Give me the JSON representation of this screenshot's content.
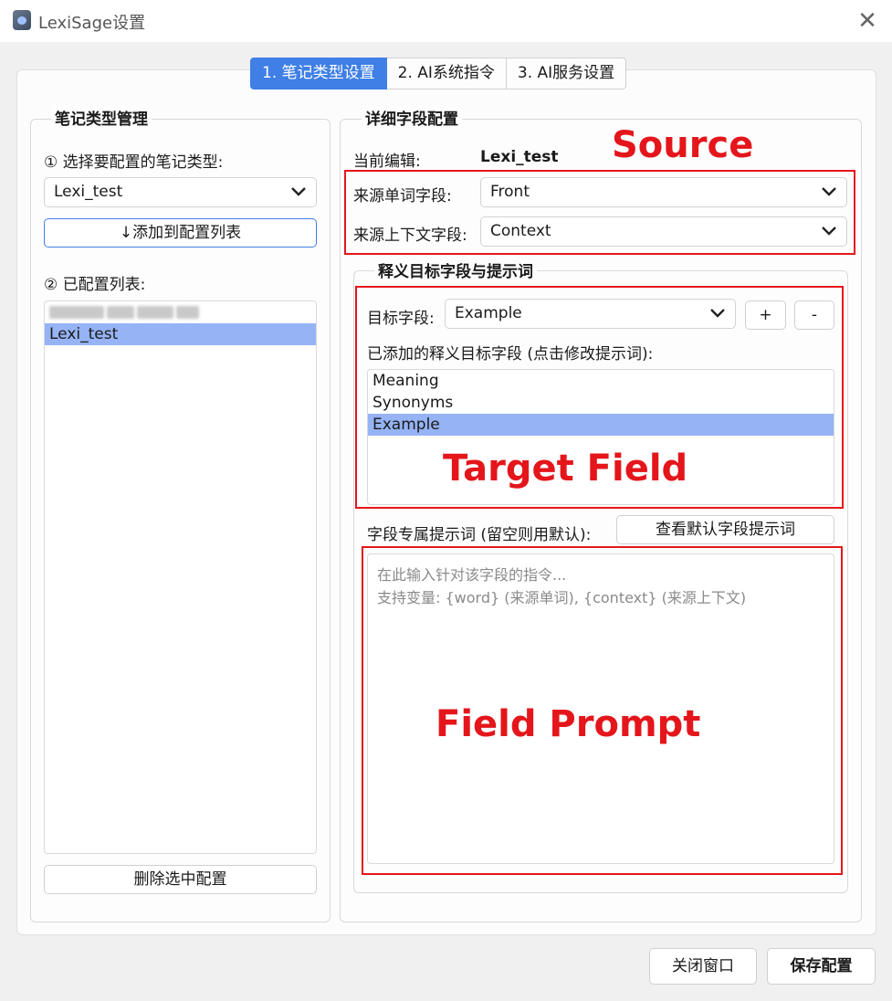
{
  "window": {
    "title": "LexiSage设置",
    "close_glyph": "✕",
    "icon": "app-icon"
  },
  "tabs": [
    {
      "label": "1. 笔记类型设置",
      "active": true
    },
    {
      "label": "2. AI系统指令",
      "active": false
    },
    {
      "label": "3. AI服务设置",
      "active": false
    }
  ],
  "left_panel": {
    "title": "笔记类型管理",
    "select_label": "① 选择要配置的笔记类型:",
    "note_type_value": "Lexi_test",
    "add_button": "↓添加到配置列表",
    "configured_label": "② 已配置列表:",
    "configured_items": [
      {
        "label": "",
        "blurred": true,
        "selected": false
      },
      {
        "label": "Lexi_test",
        "blurred": false,
        "selected": true
      }
    ],
    "delete_button": "删除选中配置"
  },
  "right_panel": {
    "title": "详细字段配置",
    "current_edit_label": "当前编辑:",
    "current_edit_value": "Lexi_test",
    "source_word_label": "来源单词字段:",
    "source_word_value": "Front",
    "source_context_label": "来源上下文字段:",
    "source_context_value": "Context",
    "target_group": {
      "title": "释义目标字段与提示词",
      "target_field_label": "目标字段:",
      "target_field_value": "Example",
      "add_button": "+",
      "remove_button": "-",
      "added_label": "已添加的释义目标字段 (点击修改提示词):",
      "added_items": [
        {
          "label": "Meaning",
          "selected": false
        },
        {
          "label": "Synonyms",
          "selected": false
        },
        {
          "label": "Example",
          "selected": true
        }
      ],
      "prompt_label": "字段专属提示词 (留空则用默认):",
      "view_default_button": "查看默认字段提示词",
      "prompt_placeholder_line1": "在此输入针对该字段的指令...",
      "prompt_placeholder_line2": "支持变量: {word} (来源单词), {context} (来源上下文)"
    }
  },
  "annotations": {
    "source": "Source",
    "target_field": "Target Field",
    "field_prompt": "Field Prompt",
    "color": "#e4161b"
  },
  "footer": {
    "close_button": "关闭窗口",
    "save_button": "保存配置"
  },
  "colors": {
    "accent": "#3f7fe6",
    "selection": "#95b3f5"
  }
}
